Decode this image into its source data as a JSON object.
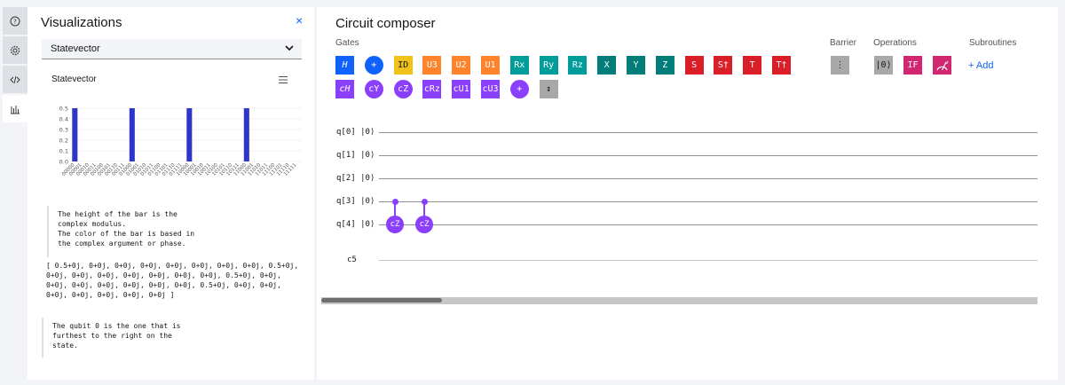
{
  "rail": {
    "items": [
      {
        "icon": "help-icon",
        "active": false
      },
      {
        "icon": "gear-icon",
        "active": false
      },
      {
        "icon": "code-icon",
        "active": false
      },
      {
        "icon": "bar-chart-icon",
        "active": true
      }
    ]
  },
  "viz": {
    "title": "Visualizations",
    "close": "×",
    "select_value": "Statevector",
    "chart_title": "Statevector",
    "note1": "The height of the bar is the\ncomplex modulus.\nThe color of the bar is based in\nthe complex argument or phase.",
    "state": "[ 0.5+0j, 0+0j, 0+0j, 0+0j, 0+0j, 0+0j, 0+0j, 0+0j, 0.5+0j, 0+0j, 0+0j, 0+0j, 0+0j, 0+0j, 0+0j, 0+0j, 0.5+0j, 0+0j, 0+0j, 0+0j, 0+0j, 0+0j, 0+0j, 0+0j, 0.5+0j, 0+0j, 0+0j, 0+0j, 0+0j, 0+0j, 0+0j, 0+0j ]",
    "note2": "The qubit 0 is the one that is\nfurthest to the right on the\nstate."
  },
  "chart_data": {
    "type": "bar",
    "title": "Statevector",
    "categories": [
      "00000",
      "00001",
      "00010",
      "00011",
      "00100",
      "00101",
      "00110",
      "00111",
      "01000",
      "01001",
      "01010",
      "01011",
      "01100",
      "01101",
      "01110",
      "01111",
      "10000",
      "10001",
      "10010",
      "10011",
      "10100",
      "10101",
      "10110",
      "10111",
      "11000",
      "11001",
      "11010",
      "11011",
      "11100",
      "11101",
      "11110",
      "11111"
    ],
    "values": [
      0.5,
      0,
      0,
      0,
      0,
      0,
      0,
      0,
      0.5,
      0,
      0,
      0,
      0,
      0,
      0,
      0,
      0.5,
      0,
      0,
      0,
      0,
      0,
      0,
      0,
      0.5,
      0,
      0,
      0,
      0,
      0,
      0,
      0
    ],
    "yticks": [
      "0.0",
      "0.1",
      "0.2",
      "0.3",
      "0.4",
      "0.5"
    ],
    "ylim": [
      0,
      0.5
    ],
    "bar_color": "#2e35c9",
    "grid": true
  },
  "composer": {
    "title": "Circuit composer",
    "labels": {
      "gates": "Gates",
      "barrier": "Barrier",
      "operations": "Operations",
      "subroutines": "Subroutines"
    },
    "add_label": "+ Add",
    "gates_row1": [
      {
        "label": "H",
        "color": "blue"
      },
      {
        "label": "+",
        "color": "blue",
        "round": true
      },
      {
        "label": "ID",
        "color": "yellow"
      },
      {
        "label": "U3",
        "color": "orange"
      },
      {
        "label": "U2",
        "color": "orange"
      },
      {
        "label": "U1",
        "color": "orange"
      },
      {
        "label": "Rx",
        "color": "teal"
      },
      {
        "label": "Ry",
        "color": "teal"
      },
      {
        "label": "Rz",
        "color": "teal"
      },
      {
        "label": "X",
        "color": "green"
      },
      {
        "label": "Y",
        "color": "green"
      },
      {
        "label": "Z",
        "color": "green"
      },
      {
        "label": "S",
        "color": "red"
      },
      {
        "label": "S†",
        "color": "red"
      },
      {
        "label": "T",
        "color": "red"
      },
      {
        "label": "T†",
        "color": "red"
      }
    ],
    "gates_row2": [
      {
        "label": "cH",
        "color": "purple"
      },
      {
        "label": "cY",
        "color": "purple",
        "round": true
      },
      {
        "label": "cZ",
        "color": "purple",
        "round": true
      },
      {
        "label": "cRz",
        "color": "purple"
      },
      {
        "label": "cU1",
        "color": "purple"
      },
      {
        "label": "cU3",
        "color": "purple"
      },
      {
        "label": "+",
        "color": "purple",
        "round": true
      },
      {
        "label": "↕",
        "color": "gray"
      }
    ],
    "barrier": {
      "label": "⋮"
    },
    "operations": [
      {
        "label": "|0⟩",
        "color": "gray"
      },
      {
        "label": "IF",
        "color": "pink"
      },
      {
        "label": "measure",
        "color": "pink"
      }
    ],
    "wires": [
      {
        "label": "q[0]",
        "ket": "|0⟩"
      },
      {
        "label": "q[1]",
        "ket": "|0⟩"
      },
      {
        "label": "q[2]",
        "ket": "|0⟩"
      },
      {
        "label": "q[3]",
        "ket": "|0⟩"
      },
      {
        "label": "q[4]",
        "ket": "|0⟩"
      }
    ],
    "classical": {
      "label": "c5"
    },
    "placed_gates": [
      {
        "label": "cZ",
        "control": 3,
        "target": 4,
        "column": 0
      },
      {
        "label": "cZ",
        "control": 3,
        "target": 4,
        "column": 1
      }
    ]
  }
}
